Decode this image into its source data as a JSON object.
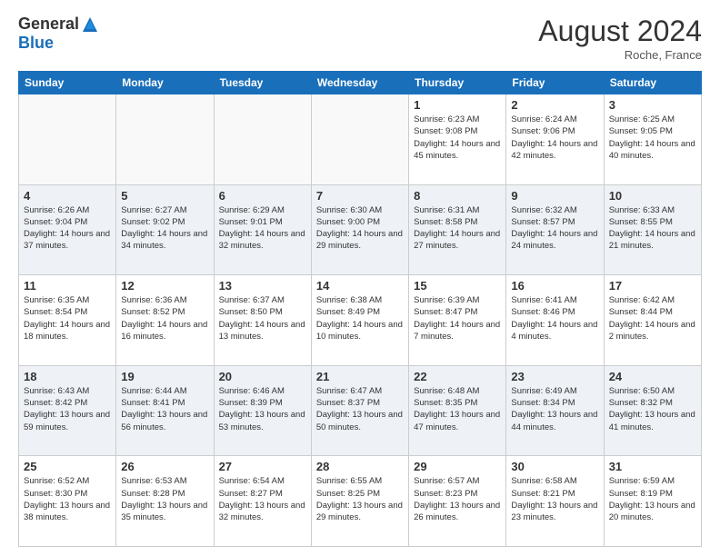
{
  "logo": {
    "general": "General",
    "blue": "Blue"
  },
  "title": "August 2024",
  "location": "Roche, France",
  "days_of_week": [
    "Sunday",
    "Monday",
    "Tuesday",
    "Wednesday",
    "Thursday",
    "Friday",
    "Saturday"
  ],
  "weeks": [
    [
      {
        "day": "",
        "info": ""
      },
      {
        "day": "",
        "info": ""
      },
      {
        "day": "",
        "info": ""
      },
      {
        "day": "",
        "info": ""
      },
      {
        "day": "1",
        "info": "Sunrise: 6:23 AM\nSunset: 9:08 PM\nDaylight: 14 hours\nand 45 minutes."
      },
      {
        "day": "2",
        "info": "Sunrise: 6:24 AM\nSunset: 9:06 PM\nDaylight: 14 hours\nand 42 minutes."
      },
      {
        "day": "3",
        "info": "Sunrise: 6:25 AM\nSunset: 9:05 PM\nDaylight: 14 hours\nand 40 minutes."
      }
    ],
    [
      {
        "day": "4",
        "info": "Sunrise: 6:26 AM\nSunset: 9:04 PM\nDaylight: 14 hours\nand 37 minutes."
      },
      {
        "day": "5",
        "info": "Sunrise: 6:27 AM\nSunset: 9:02 PM\nDaylight: 14 hours\nand 34 minutes."
      },
      {
        "day": "6",
        "info": "Sunrise: 6:29 AM\nSunset: 9:01 PM\nDaylight: 14 hours\nand 32 minutes."
      },
      {
        "day": "7",
        "info": "Sunrise: 6:30 AM\nSunset: 9:00 PM\nDaylight: 14 hours\nand 29 minutes."
      },
      {
        "day": "8",
        "info": "Sunrise: 6:31 AM\nSunset: 8:58 PM\nDaylight: 14 hours\nand 27 minutes."
      },
      {
        "day": "9",
        "info": "Sunrise: 6:32 AM\nSunset: 8:57 PM\nDaylight: 14 hours\nand 24 minutes."
      },
      {
        "day": "10",
        "info": "Sunrise: 6:33 AM\nSunset: 8:55 PM\nDaylight: 14 hours\nand 21 minutes."
      }
    ],
    [
      {
        "day": "11",
        "info": "Sunrise: 6:35 AM\nSunset: 8:54 PM\nDaylight: 14 hours\nand 18 minutes."
      },
      {
        "day": "12",
        "info": "Sunrise: 6:36 AM\nSunset: 8:52 PM\nDaylight: 14 hours\nand 16 minutes."
      },
      {
        "day": "13",
        "info": "Sunrise: 6:37 AM\nSunset: 8:50 PM\nDaylight: 14 hours\nand 13 minutes."
      },
      {
        "day": "14",
        "info": "Sunrise: 6:38 AM\nSunset: 8:49 PM\nDaylight: 14 hours\nand 10 minutes."
      },
      {
        "day": "15",
        "info": "Sunrise: 6:39 AM\nSunset: 8:47 PM\nDaylight: 14 hours\nand 7 minutes."
      },
      {
        "day": "16",
        "info": "Sunrise: 6:41 AM\nSunset: 8:46 PM\nDaylight: 14 hours\nand 4 minutes."
      },
      {
        "day": "17",
        "info": "Sunrise: 6:42 AM\nSunset: 8:44 PM\nDaylight: 14 hours\nand 2 minutes."
      }
    ],
    [
      {
        "day": "18",
        "info": "Sunrise: 6:43 AM\nSunset: 8:42 PM\nDaylight: 13 hours\nand 59 minutes."
      },
      {
        "day": "19",
        "info": "Sunrise: 6:44 AM\nSunset: 8:41 PM\nDaylight: 13 hours\nand 56 minutes."
      },
      {
        "day": "20",
        "info": "Sunrise: 6:46 AM\nSunset: 8:39 PM\nDaylight: 13 hours\nand 53 minutes."
      },
      {
        "day": "21",
        "info": "Sunrise: 6:47 AM\nSunset: 8:37 PM\nDaylight: 13 hours\nand 50 minutes."
      },
      {
        "day": "22",
        "info": "Sunrise: 6:48 AM\nSunset: 8:35 PM\nDaylight: 13 hours\nand 47 minutes."
      },
      {
        "day": "23",
        "info": "Sunrise: 6:49 AM\nSunset: 8:34 PM\nDaylight: 13 hours\nand 44 minutes."
      },
      {
        "day": "24",
        "info": "Sunrise: 6:50 AM\nSunset: 8:32 PM\nDaylight: 13 hours\nand 41 minutes."
      }
    ],
    [
      {
        "day": "25",
        "info": "Sunrise: 6:52 AM\nSunset: 8:30 PM\nDaylight: 13 hours\nand 38 minutes."
      },
      {
        "day": "26",
        "info": "Sunrise: 6:53 AM\nSunset: 8:28 PM\nDaylight: 13 hours\nand 35 minutes."
      },
      {
        "day": "27",
        "info": "Sunrise: 6:54 AM\nSunset: 8:27 PM\nDaylight: 13 hours\nand 32 minutes."
      },
      {
        "day": "28",
        "info": "Sunrise: 6:55 AM\nSunset: 8:25 PM\nDaylight: 13 hours\nand 29 minutes."
      },
      {
        "day": "29",
        "info": "Sunrise: 6:57 AM\nSunset: 8:23 PM\nDaylight: 13 hours\nand 26 minutes."
      },
      {
        "day": "30",
        "info": "Sunrise: 6:58 AM\nSunset: 8:21 PM\nDaylight: 13 hours\nand 23 minutes."
      },
      {
        "day": "31",
        "info": "Sunrise: 6:59 AM\nSunset: 8:19 PM\nDaylight: 13 hours\nand 20 minutes."
      }
    ]
  ]
}
